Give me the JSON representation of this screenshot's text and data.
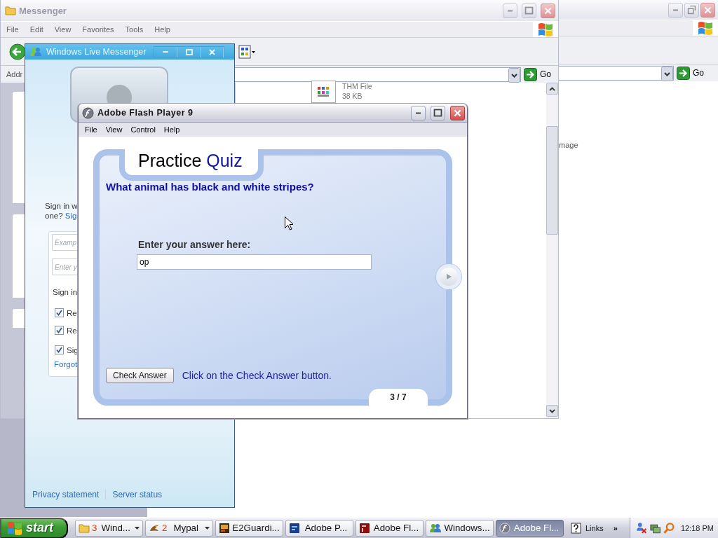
{
  "background_window": {
    "go_button": "Go",
    "content_text": "mage"
  },
  "explorer_window": {
    "title": "Messenger",
    "menu": [
      "File",
      "Edit",
      "View",
      "Favorites",
      "Tools",
      "Help"
    ],
    "address_label": "Addr",
    "go_button": "Go",
    "file": {
      "name": "THM File",
      "size": "38 KB"
    }
  },
  "messenger_window": {
    "title": "Windows Live Messenger",
    "sign_in_line": "Sign in w",
    "sign_up_prefix": "one?",
    "sign_up_link": "Sig",
    "email_field": {
      "placeholder": "Examp"
    },
    "password_field": {
      "placeholder": "Enter y"
    },
    "sign_in_as": "Sign in",
    "options": [
      {
        "label": "Re",
        "checked": true
      },
      {
        "label": "Re",
        "checked": true
      },
      {
        "label": "Sig",
        "checked": true
      }
    ],
    "forgot_link": "Forgot",
    "footer_links": [
      "Privacy statement",
      "Server status"
    ]
  },
  "flash_window": {
    "title": "Adobe Flash Player 9",
    "menu": [
      "File",
      "View",
      "Control",
      "Help"
    ],
    "quiz": {
      "title": "Practice",
      "title_highlight": "Quiz",
      "question": "What animal has black and white stripes?",
      "answer_label": "Enter your answer here:",
      "answer": {
        "value": "op"
      },
      "check_button": "Check Answer",
      "hint": "Click on the Check Answer button.",
      "progress": "3 / 7"
    }
  },
  "taskbar": {
    "start": "start",
    "tasks": [
      {
        "kind": "folder",
        "count": "3",
        "label": "Wind...",
        "grouped": true,
        "selected": false
      },
      {
        "kind": "browser",
        "count": "2",
        "label": "Mypal",
        "grouped": true,
        "selected": false
      },
      {
        "kind": "app",
        "label": "E2Guardi...",
        "grouped": false,
        "selected": false
      },
      {
        "kind": "photo",
        "label": "Adobe P...",
        "grouped": false,
        "selected": false
      },
      {
        "kind": "authoring",
        "label": "Adobe Fl...",
        "grouped": false,
        "selected": false
      },
      {
        "kind": "messenger",
        "label": "Windows...",
        "grouped": false,
        "selected": false
      },
      {
        "kind": "player",
        "label": "Adobe Fl...",
        "grouped": false,
        "selected": true
      }
    ],
    "links": "Links",
    "chevron": "»",
    "clock": "12:18 PM"
  }
}
